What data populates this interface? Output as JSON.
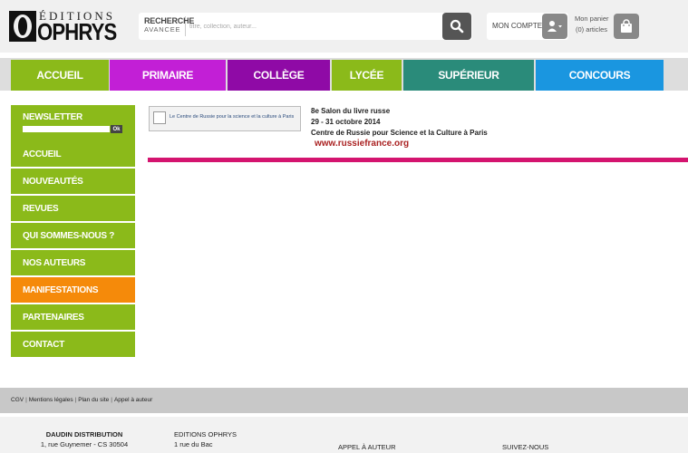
{
  "header": {
    "logo_top": "ÉDITIONS",
    "logo_main": "OPHRYS",
    "search_adv_line1": "RECHERCHE",
    "search_adv_line2": "AVANCEE",
    "search_placeholder": "titre, collection, auteur...",
    "account_label": "MON COMPTE",
    "cart_label": "Mon panier",
    "cart_count": "(0) articles"
  },
  "nav": {
    "tabs": [
      {
        "label": "ACCUEIL",
        "color": "#8bba1a"
      },
      {
        "label": "PRIMAIRE",
        "color": "#c21fd6"
      },
      {
        "label": "COLLÈGE",
        "color": "#8f0aa6"
      },
      {
        "label": "LYCÉE",
        "color": "#8bba1a"
      },
      {
        "label": "SUPÉRIEUR",
        "color": "#2a8b7a"
      },
      {
        "label": "CONCOURS",
        "color": "#1a96e0"
      }
    ]
  },
  "sidebar": {
    "newsletter_label": "NEWSLETTER",
    "newsletter_ok": "Ok",
    "items": [
      {
        "label": "ACCUEIL"
      },
      {
        "label": "NOUVEAUTÉS"
      },
      {
        "label": "REVUES"
      },
      {
        "label": "QUI SOMMES-NOUS ?"
      },
      {
        "label": "NOS AUTEURS"
      },
      {
        "label": "MANIFESTATIONS"
      },
      {
        "label": "PARTENAIRES"
      },
      {
        "label": "CONTACT"
      }
    ],
    "active_color": "#f58a0a",
    "color": "#8bba1a"
  },
  "event": {
    "image_caption": "Le Centre de Russie pour la science et la culture à Paris",
    "line1": "8e Salon du livre russe",
    "line2": "29 - 31 octobre 2014",
    "line3": "Centre de Russie pour Science et la Culture à Paris",
    "url": "www.russiefrance.org"
  },
  "footer_links": [
    "CGV",
    "Mentions légales",
    "Plan du site",
    "Appel à auteur"
  ],
  "footer": {
    "dist_title": "DAUDIN DISTRIBUTION",
    "dist_line1": "1, rue Guynemer - CS 30504",
    "ed_title": "EDITIONS OPHRYS",
    "ed_line1": "1 rue du Bac",
    "appel": "APPEL À AUTEUR",
    "suivez": "SUIVEZ-NOUS"
  }
}
